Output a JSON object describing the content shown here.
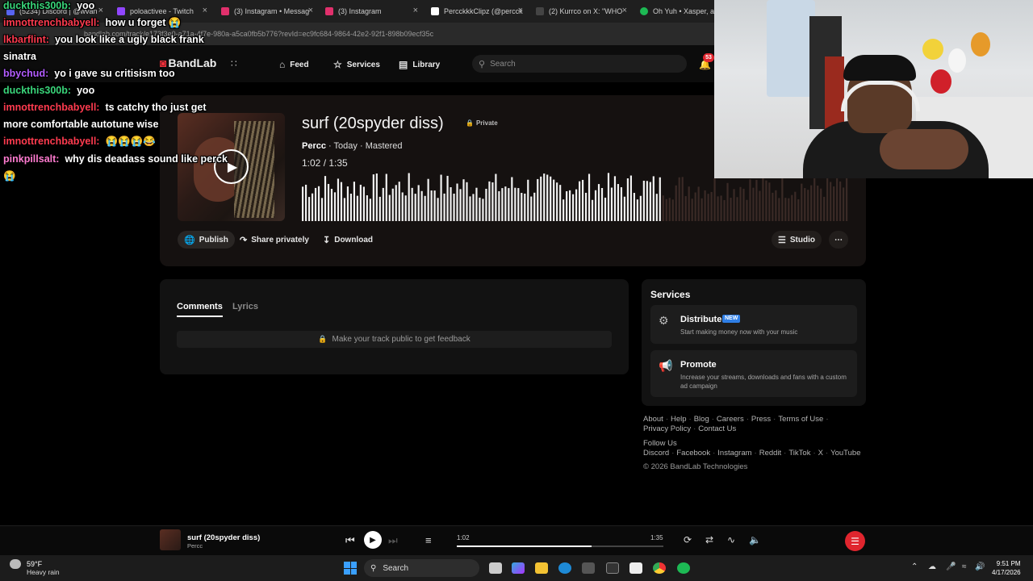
{
  "browser": {
    "tabs": [
      {
        "title": "(5234) Discord | @wvan",
        "color": "#5865f2"
      },
      {
        "title": "poloactivee - Twitch",
        "color": "#9146ff"
      },
      {
        "title": "(3) Instagram • Messag",
        "color": "#e1306c"
      },
      {
        "title": "(3) Instagram",
        "color": "#e1306c"
      },
      {
        "title": "PercckkkClipz (@percck",
        "color": "#ffffff"
      },
      {
        "title": "(2) Kurrco on X: \"WHO",
        "color": "#000000"
      },
      {
        "title": "Oh Yuh • Xasper, alos",
        "color": "#1db954"
      }
    ],
    "url": "bandlab.com/track/e173f3e0-a71a-4f7e-980a-a5ca0fb5b776?revId=ec9fc684-9864-42e2-92f1-898b09ecf35c"
  },
  "header": {
    "logo": "BandLab",
    "nav": [
      {
        "label": "Feed",
        "icon": "home-icon"
      },
      {
        "label": "Services",
        "icon": "star-icon"
      },
      {
        "label": "Library",
        "icon": "library-icon"
      }
    ],
    "search_placeholder": "Search",
    "notification_count": "53"
  },
  "track": {
    "title": "surf (20spyder diss)",
    "visibility": "Private",
    "artist": "Percc",
    "meta_rest": " · Today · Mastered",
    "time": "1:02 / 1:35",
    "progress": 0.653,
    "buttons": {
      "publish": "Publish",
      "share": "Share privately",
      "download": "Download",
      "studio": "Studio",
      "more": "⋯"
    }
  },
  "comments": {
    "tabs": [
      "Comments",
      "Lyrics"
    ],
    "notice": "Make your track public to get feedback"
  },
  "services": {
    "title": "Services",
    "items": [
      {
        "name": "Distribute",
        "badge": "NEW",
        "desc": "Start making money now with your music"
      },
      {
        "name": "Promote",
        "desc": "Increase your streams, downloads and fans with a custom ad campaign"
      }
    ]
  },
  "footer": {
    "links_row1": [
      "About",
      "Help",
      "Blog",
      "Careers",
      "Press",
      "Terms of Use"
    ],
    "links_row2": [
      "Privacy Policy",
      "Contact Us"
    ],
    "follow_label": "Follow Us",
    "social": [
      "Discord",
      "Facebook",
      "Instagram",
      "Reddit",
      "TikTok",
      "X",
      "YouTube"
    ],
    "copyright": "© 2026 BandLab Technologies"
  },
  "player": {
    "title": "surf (20spyder diss)",
    "artist": "Percc",
    "elapsed": "1:02",
    "total": "1:35",
    "progress": 0.653
  },
  "taskbar": {
    "temp": "59°F",
    "condition": "Heavy rain",
    "search": "Search",
    "time": "9:51 PM",
    "date": "4/17/2026"
  },
  "chat": [
    {
      "user": "duckthis300b:",
      "msg": "yoo",
      "color": "green"
    },
    {
      "user": "imnottrenchbabyell:",
      "msg": "how u forget 😭",
      "color": "red"
    },
    {
      "user": "lkbarflint:",
      "msg": "you look like a ugly black frank",
      "color": "red"
    },
    {
      "user": "",
      "msg": "sinatra",
      "color": ""
    },
    {
      "user": "bbychud:",
      "msg": "yo i gave su critisism too",
      "color": "purple"
    },
    {
      "user": "duckthis300b:",
      "msg": "yoo",
      "color": "green"
    },
    {
      "user": "imnottrenchbabyell:",
      "msg": "ts catchy tho just get",
      "color": "red"
    },
    {
      "user": "",
      "msg": "more comfortable autotune wise",
      "color": ""
    },
    {
      "user": "imnottrenchbabyell:",
      "msg": "😭😭😭😂",
      "color": "red"
    },
    {
      "user": "pinkpillsalt:",
      "msg": "why dis deadass sound like perck",
      "color": "pink"
    },
    {
      "user": "",
      "msg": "😭",
      "color": ""
    }
  ],
  "colors": {
    "accent": "#e0252e",
    "background": "#000000",
    "card": "#151110"
  }
}
